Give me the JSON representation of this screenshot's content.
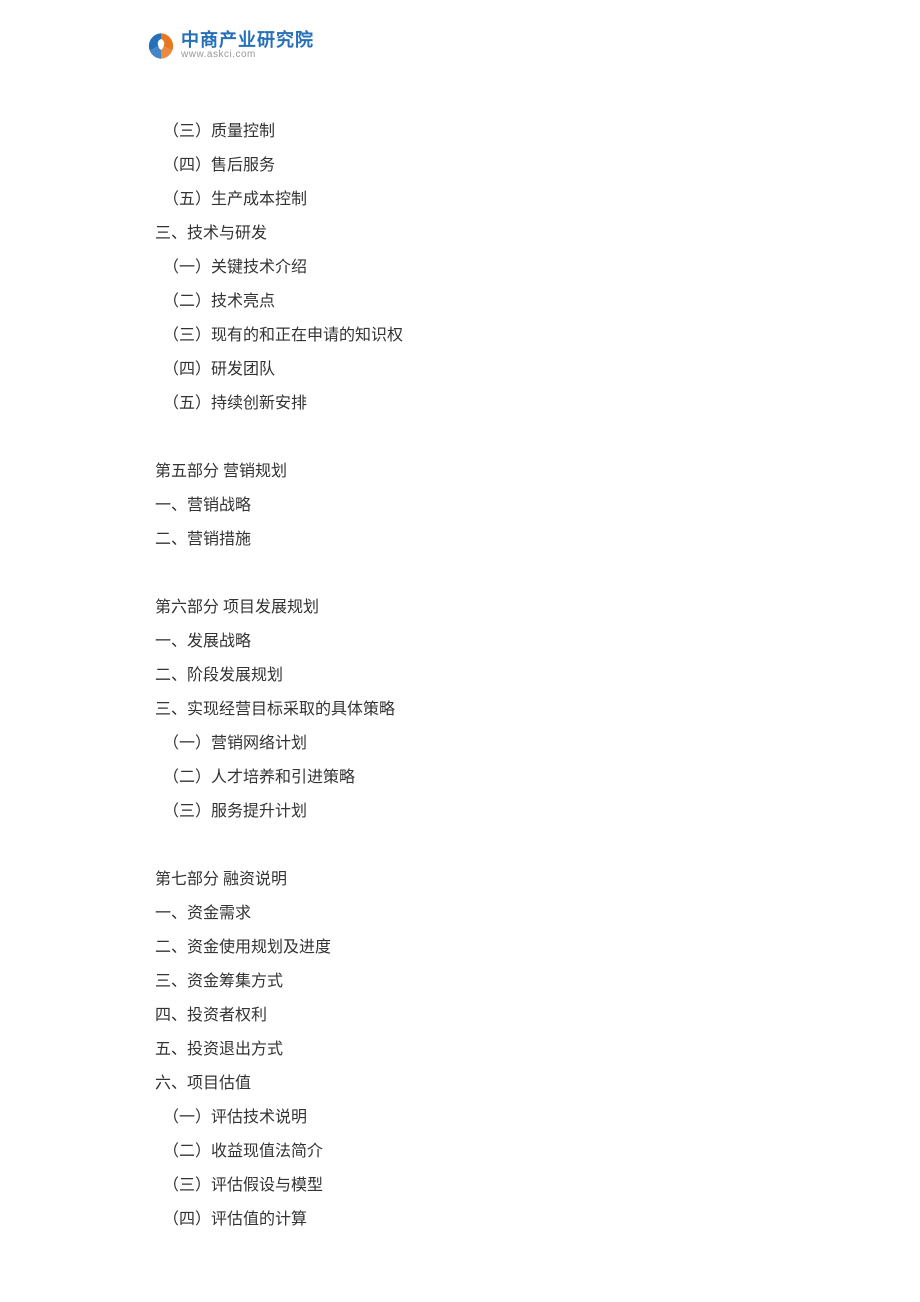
{
  "logo": {
    "title": "中商产业研究院",
    "url": "www.askci.com"
  },
  "content": {
    "items": [
      {
        "text": "（三）质量控制",
        "type": "sub"
      },
      {
        "text": "（四）售后服务",
        "type": "sub"
      },
      {
        "text": "（五）生产成本控制",
        "type": "sub"
      },
      {
        "text": "三、技术与研发",
        "type": "line"
      },
      {
        "text": "（一）关键技术介绍",
        "type": "sub"
      },
      {
        "text": "（二）技术亮点",
        "type": "sub"
      },
      {
        "text": "（三）现有的和正在申请的知识权",
        "type": "sub"
      },
      {
        "text": "（四）研发团队",
        "type": "sub"
      },
      {
        "text": "（五）持续创新安排",
        "type": "sub"
      },
      {
        "text": "",
        "type": "spacer"
      },
      {
        "text": "第五部分  营销规划",
        "type": "line"
      },
      {
        "text": "一、营销战略",
        "type": "line"
      },
      {
        "text": "二、营销措施",
        "type": "line"
      },
      {
        "text": "",
        "type": "spacer"
      },
      {
        "text": "第六部分  项目发展规划",
        "type": "line"
      },
      {
        "text": "一、发展战略",
        "type": "line"
      },
      {
        "text": "二、阶段发展规划",
        "type": "line"
      },
      {
        "text": "三、实现经营目标采取的具体策略",
        "type": "line"
      },
      {
        "text": "（一）营销网络计划",
        "type": "sub"
      },
      {
        "text": "（二）人才培养和引进策略",
        "type": "sub"
      },
      {
        "text": "（三）服务提升计划",
        "type": "sub"
      },
      {
        "text": "",
        "type": "spacer"
      },
      {
        "text": "第七部分  融资说明",
        "type": "line"
      },
      {
        "text": "一、资金需求",
        "type": "line"
      },
      {
        "text": "二、资金使用规划及进度",
        "type": "line"
      },
      {
        "text": "三、资金筹集方式",
        "type": "line"
      },
      {
        "text": "四、投资者权利",
        "type": "line"
      },
      {
        "text": "五、投资退出方式",
        "type": "line"
      },
      {
        "text": "六、项目估值",
        "type": "line"
      },
      {
        "text": "（一）评估技术说明",
        "type": "sub"
      },
      {
        "text": "（二）收益现值法简介",
        "type": "sub"
      },
      {
        "text": "（三）评估假设与模型",
        "type": "sub"
      },
      {
        "text": "（四）评估值的计算",
        "type": "sub"
      }
    ]
  }
}
